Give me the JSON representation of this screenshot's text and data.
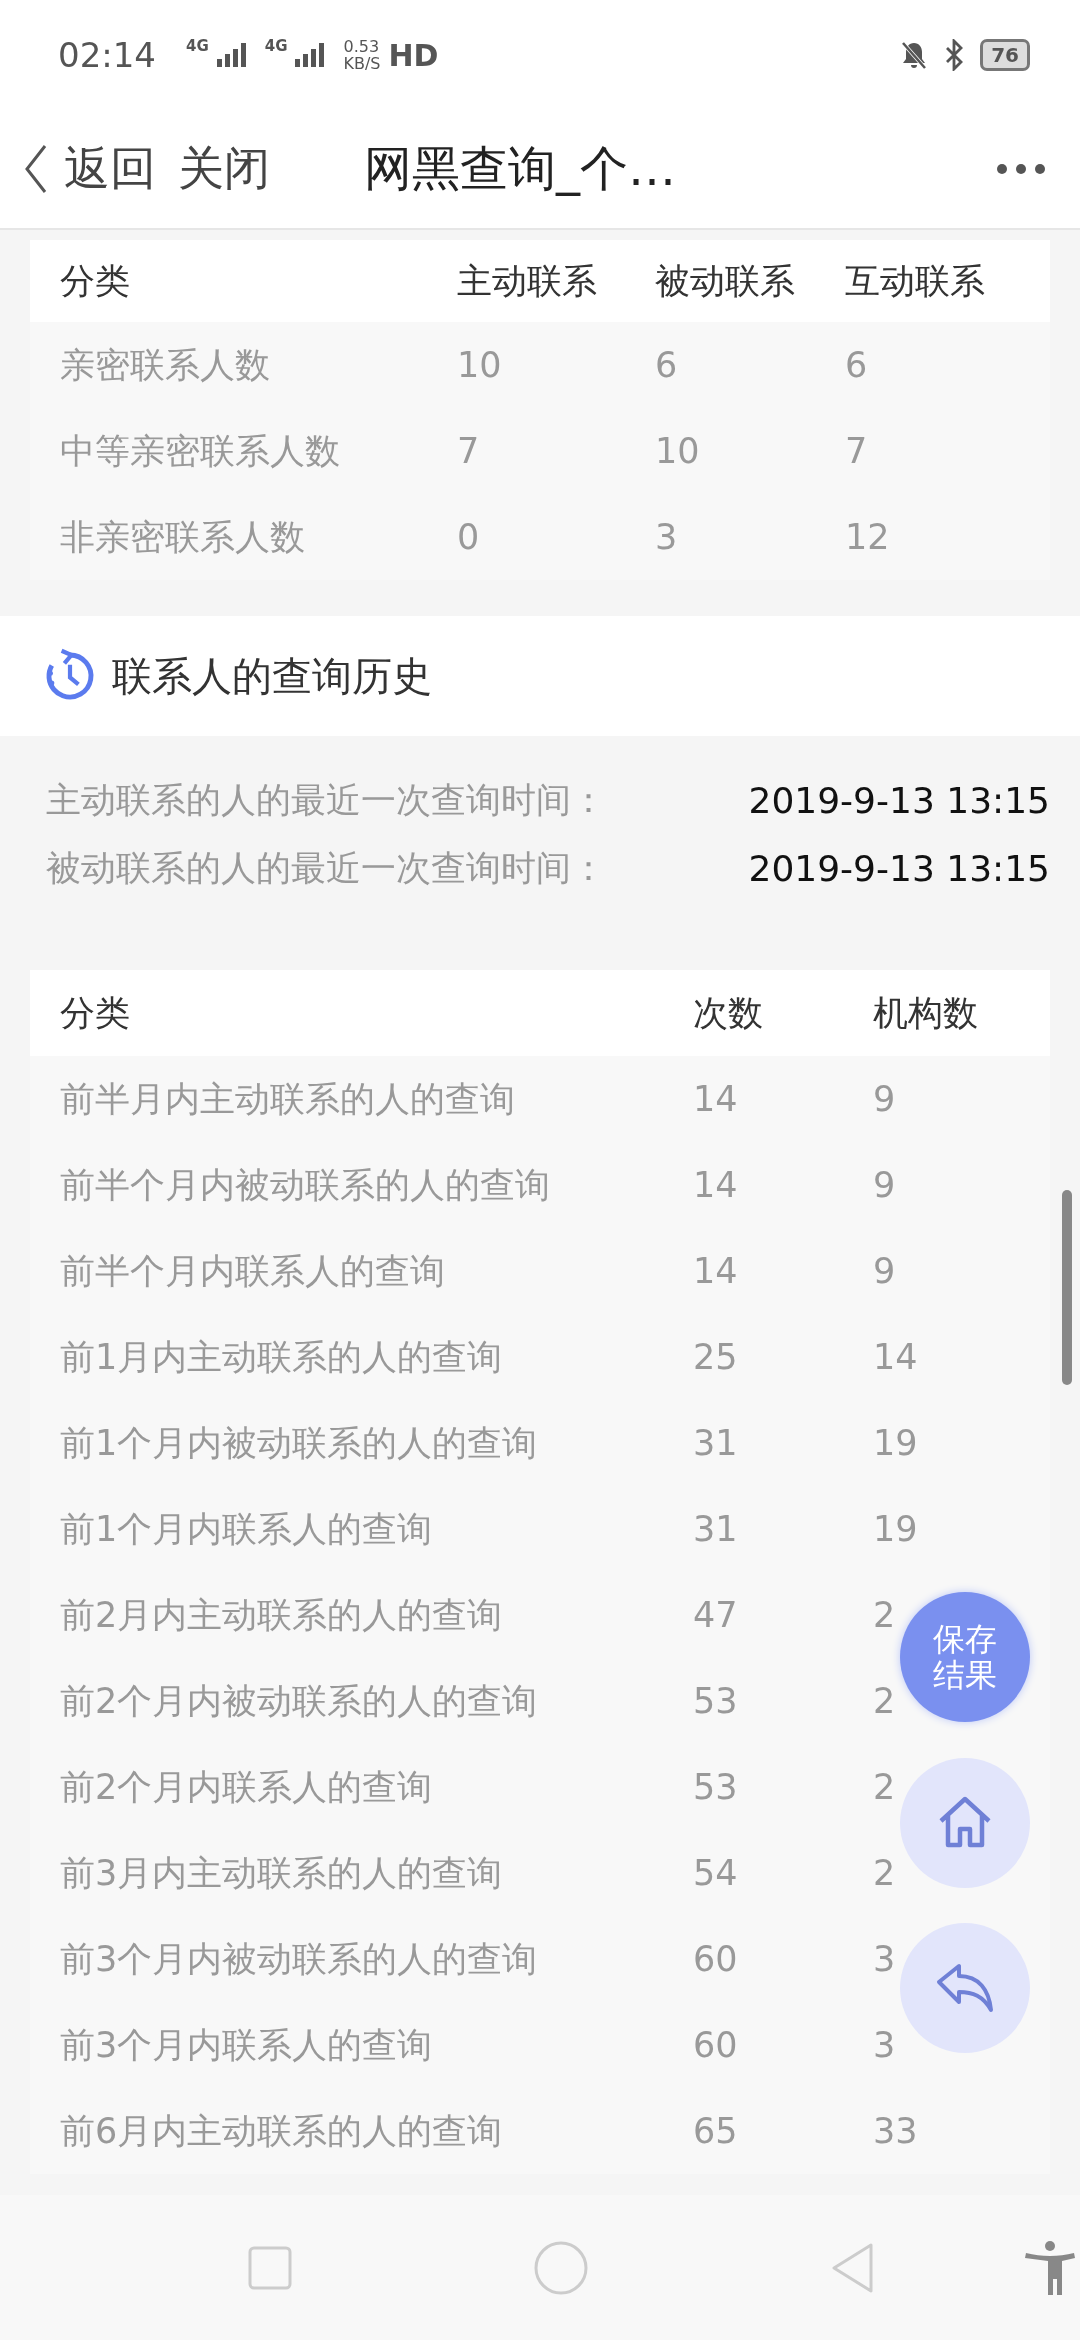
{
  "status_bar": {
    "time": "02:14",
    "networks": [
      "4G",
      "4G"
    ],
    "speed_value": "0.53",
    "speed_unit": "KB/S",
    "hd": "HD",
    "battery": "76"
  },
  "nav": {
    "back": "返回",
    "close": "关闭",
    "title": "网黑查询_个…"
  },
  "contact_table": {
    "columns": [
      "分类",
      "主动联系",
      "被动联系",
      "互动联系"
    ],
    "rows": [
      {
        "cells": [
          "亲密联系人数",
          "10",
          "6",
          "6"
        ]
      },
      {
        "cells": [
          "中等亲密联系人数",
          "7",
          "10",
          "7"
        ]
      },
      {
        "cells": [
          "非亲密联系人数",
          "0",
          "3",
          "12"
        ]
      }
    ]
  },
  "history": {
    "title": "联系人的查询历史",
    "lines": [
      {
        "label": "主动联系的人的最近一次查询时间：",
        "value": "2019-9-13 13:15"
      },
      {
        "label": "被动联系的人的最近一次查询时间：",
        "value": "2019-9-13 13:15"
      }
    ]
  },
  "query_table": {
    "columns": [
      "分类",
      "次数",
      "机构数"
    ],
    "rows": [
      {
        "cells": [
          "前半月内主动联系的人的查询",
          "14",
          "9"
        ]
      },
      {
        "cells": [
          "前半个月内被动联系的人的查询",
          "14",
          "9"
        ]
      },
      {
        "cells": [
          "前半个月内联系人的查询",
          "14",
          "9"
        ]
      },
      {
        "cells": [
          "前1月内主动联系的人的查询",
          "25",
          "14"
        ]
      },
      {
        "cells": [
          "前1个月内被动联系的人的查询",
          "31",
          "19"
        ]
      },
      {
        "cells": [
          "前1个月内联系人的查询",
          "31",
          "19"
        ]
      },
      {
        "cells": [
          "前2月内主动联系的人的查询",
          "47",
          "2"
        ]
      },
      {
        "cells": [
          "前2个月内被动联系的人的查询",
          "53",
          "2"
        ]
      },
      {
        "cells": [
          "前2个月内联系人的查询",
          "53",
          "2"
        ]
      },
      {
        "cells": [
          "前3月内主动联系的人的查询",
          "54",
          "2"
        ]
      },
      {
        "cells": [
          "前3个月内被动联系的人的查询",
          "60",
          "3"
        ]
      },
      {
        "cells": [
          "前3个月内联系人的查询",
          "60",
          "3"
        ]
      },
      {
        "cells": [
          "前6月内主动联系的人的查询",
          "65",
          "33"
        ]
      }
    ]
  },
  "fab": {
    "save": "保存结果"
  }
}
